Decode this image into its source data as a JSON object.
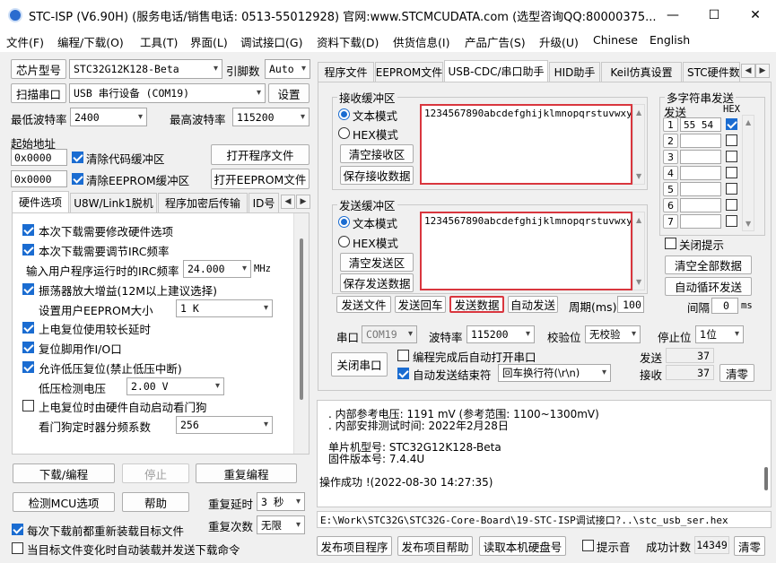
{
  "title": "STC-ISP (V6.90H) (服务电话/销售电话: 0513-55012928) 官网:www.STCMCUDATA.com  (选型咨询QQ:80000375...",
  "window_buttons": {
    "minimize": "—",
    "maximize": "☐",
    "close": "✕"
  },
  "menu": [
    "文件(F)",
    "编程/下载(O)",
    "工具(T)",
    "界面(L)",
    "调试接口(G)",
    "资料下载(D)",
    "供货信息(I)",
    "产品广告(S)",
    "升级(U)",
    "Chinese",
    "English"
  ],
  "left": {
    "chip_btn": "芯片型号",
    "chip_value": "STC32G12K128-Beta",
    "ref_label": "引脚数",
    "ref_value": "Auto",
    "scan_btn": "扫描串口",
    "port_value": "USB 串行设备 (COM19)",
    "settings_btn": "设置",
    "min_baud_label": "最低波特率",
    "min_baud": "2400",
    "max_baud_label": "最高波特率",
    "max_baud": "115200",
    "start_addr_label": "起始地址",
    "addr1": "0x0000",
    "clear_code": "清除代码缓冲区",
    "open_prog": "打开程序文件",
    "addr2": "0x0000",
    "clear_eeprom": "清除EEPROM缓冲区",
    "open_eeprom": "打开EEPROM文件",
    "tabs": [
      "硬件选项",
      "U8W/Link1脱机",
      "程序加密后传输",
      "ID号"
    ],
    "hw": {
      "o1": "本次下载需要修改硬件选项",
      "o2": "本次下载需要调节IRC频率",
      "irc_label": "输入用户程序运行时的IRC频率",
      "irc_value": "24.000",
      "irc_unit": "MHz",
      "o3": "振荡器放大增益(12M以上建议选择)",
      "eeprom_label": "设置用户EEPROM大小",
      "eeprom_value": "1    K",
      "o4": "上电复位使用较长延时",
      "o5": "复位脚用作I/O口",
      "o6": "允许低压复位(禁止低压中断)",
      "lv_label": "低压检测电压",
      "lv_value": "2.00 V",
      "o7": "上电复位时由硬件自动启动看门狗",
      "wd_label": "看门狗定时器分频系数",
      "wd_value": "256"
    },
    "download": "下载/编程",
    "stop": "停止",
    "reprog": "重复编程",
    "detect": "检测MCU选项",
    "help": "帮助",
    "delay_label": "重复延时",
    "delay_value": "3 秒",
    "count_label": "重复次数",
    "count_value": "无限",
    "reload1": "每次下载前都重新装载目标文件",
    "reload2": "当目标文件变化时自动装载并发送下载命令"
  },
  "right": {
    "tabs": [
      "程序文件",
      "EEPROM文件",
      "USB-CDC/串口助手",
      "HID助手",
      "Keil仿真设置",
      "STC硬件数"
    ],
    "recv": {
      "title": "接收缓冲区",
      "text_mode": "文本模式",
      "hex_mode": "HEX模式",
      "clear": "清空接收区",
      "save": "保存接收数据",
      "content": "1234567890abcdefghijklmnopqrstuvwxy"
    },
    "send": {
      "title": "发送缓冲区",
      "text_mode": "文本模式",
      "hex_mode": "HEX模式",
      "clear": "清空发送区",
      "save": "保存发送数据",
      "content": "1234567890abcdefghijklmnopqrstuvwxy"
    },
    "multi": {
      "title": "多字符串发送",
      "send_col": "发送",
      "hex_col": "HEX",
      "rows": [
        {
          "n": "1",
          "v": "55 54 "
        },
        {
          "n": "2",
          "v": ""
        },
        {
          "n": "3",
          "v": ""
        },
        {
          "n": "4",
          "v": ""
        },
        {
          "n": "5",
          "v": ""
        },
        {
          "n": "6",
          "v": ""
        },
        {
          "n": "7",
          "v": ""
        }
      ],
      "close_tip": "关闭提示",
      "clear_all": "清空全部数据",
      "auto_loop": "自动循环发送",
      "interval_label": "间隔",
      "interval": "0",
      "interval_unit": "ms"
    },
    "send_file": "发送文件",
    "send_back": "发送回车",
    "send_data": "发送数据",
    "auto_send": "自动发送",
    "period_label": "周期(ms)",
    "period": "100",
    "port_label": "串口",
    "port": "COM19",
    "baud_label": "波特率",
    "baud": "115200",
    "parity_label": "校验位",
    "parity": "无校验",
    "stop_label": "停止位",
    "stop": "1位",
    "close_port": "关闭串口",
    "auto_open": "编程完成后自动打开串口",
    "auto_end": "自动发送结束符",
    "end_value": "回车换行符(\\r\\n)",
    "sent_label": "发送",
    "sent": "37",
    "recv_label": "接收",
    "recv_count": "37",
    "clear_zero": "清零"
  },
  "log": [
    ". 内部参考电压: 1191 mV (参考范围: 1100~1300mV)",
    ". 内部安排测试时间: 2022年2月28日",
    "单片机型号: STC32G12K128-Beta",
    "固件版本号: 7.4.4U",
    "操作成功 !(2022-08-30 14:27:35)"
  ],
  "path": "E:\\Work\\STC32G\\STC32G-Core-Board\\19-STC-ISP调试接口?..\\stc_usb_ser.hex",
  "bottom": {
    "publish": "发布项目程序",
    "publish_help": "发布项目帮助",
    "read_id": "读取本机硬盘号",
    "sound": "提示音",
    "success_label": "成功计数",
    "success": "14349",
    "clear": "清零"
  }
}
